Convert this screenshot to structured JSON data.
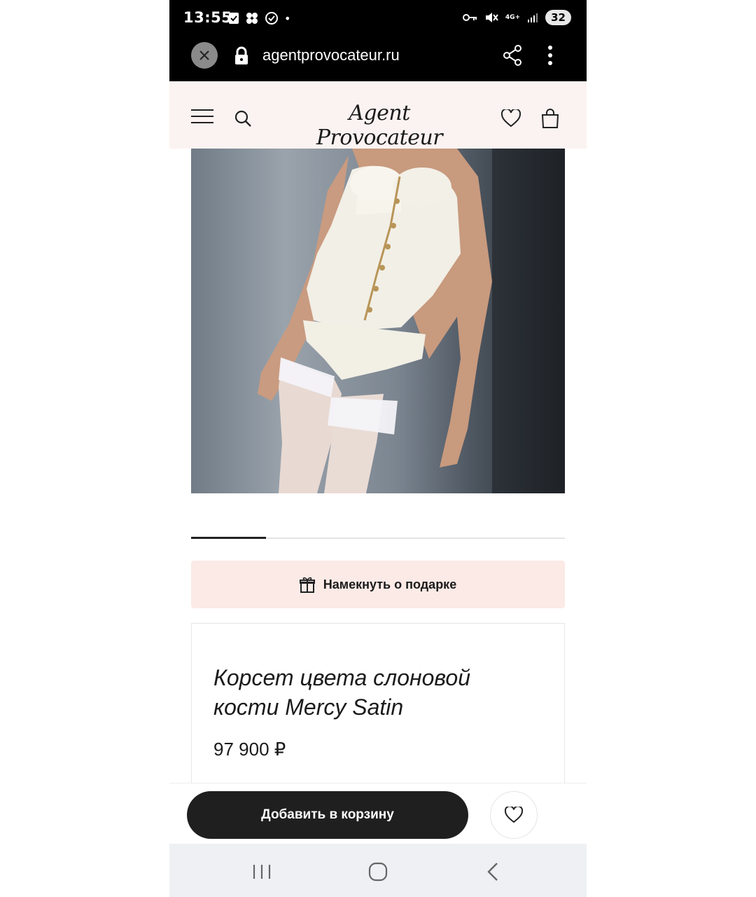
{
  "status_bar": {
    "time": "13:55",
    "battery": "32",
    "network": "4G+"
  },
  "browser": {
    "url": "agentprovocateur.ru"
  },
  "site": {
    "logo_text": "Agent Provocateur"
  },
  "carousel": {
    "active_index": 1,
    "total": 5
  },
  "gift_hint": {
    "label": "Намекнуть о подарке"
  },
  "product": {
    "title": "Корсет цвета слоновой кости Mercy Satin",
    "price": "97 900 ₽"
  },
  "actions": {
    "add_to_cart_label": "Добавить в корзину"
  },
  "colors": {
    "header_bg": "#fbf3f1",
    "gift_bg": "#fbeae6",
    "button_dark": "#1f1f1f"
  },
  "icons": [
    "close-icon",
    "lock-icon",
    "share-icon",
    "more-icon",
    "menu-icon",
    "search-icon",
    "heart-icon",
    "bag-icon",
    "gift-icon",
    "recents-icon",
    "home-icon",
    "back-icon"
  ]
}
